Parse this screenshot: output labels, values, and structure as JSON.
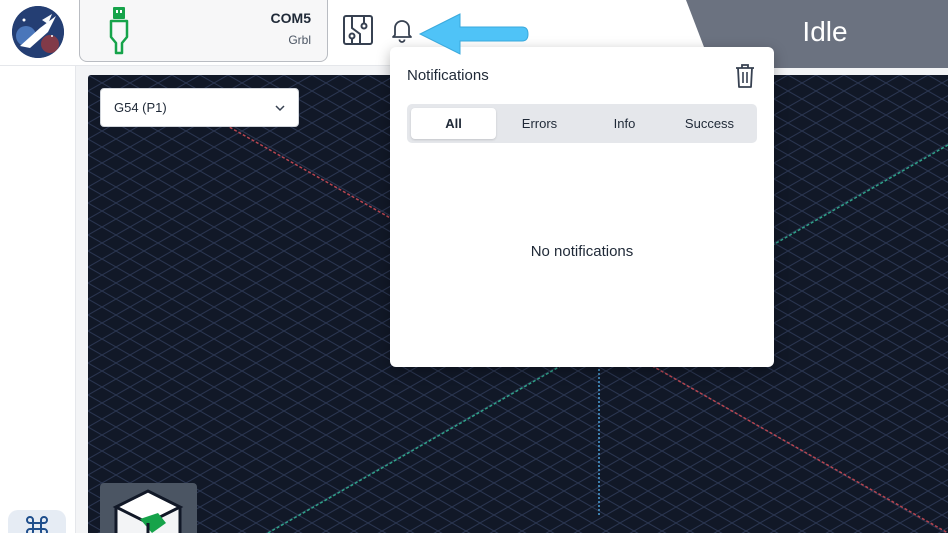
{
  "header": {
    "logo_icon": "rocket-logo-icon",
    "connection": {
      "port": "COM5",
      "firmware": "Grbl",
      "icon": "usb-icon"
    },
    "diagram_icon": "circuit-board-icon",
    "bell_icon": "bell-icon",
    "status": "Idle"
  },
  "visualizer": {
    "wcs_select": {
      "value": "G54 (P1)"
    },
    "cube_icon": "view-cube-icon"
  },
  "notifications": {
    "title": "Notifications",
    "clear_icon": "trash-icon",
    "tabs": [
      {
        "label": "All",
        "active": true
      },
      {
        "label": "Errors",
        "active": false
      },
      {
        "label": "Info",
        "active": false
      },
      {
        "label": "Success",
        "active": false
      }
    ],
    "empty_text": "No notifications"
  },
  "sidebar": {
    "command_icon": "command-icon"
  },
  "colors": {
    "status_bg": "#6b7280",
    "arrow": "#4fc3f7",
    "usb": "#16a34a",
    "grid_bg": "#111827"
  }
}
